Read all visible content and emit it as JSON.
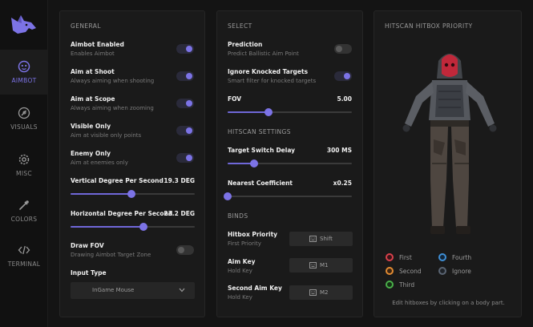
{
  "sidebar": {
    "items": [
      {
        "label": "AIMBOT",
        "icon": "aimbot-face-icon",
        "active": true
      },
      {
        "label": "VISUALS",
        "icon": "visuals-eye-icon"
      },
      {
        "label": "MISC",
        "icon": "gear-icon"
      },
      {
        "label": "COLORS",
        "icon": "eyedropper-icon"
      },
      {
        "label": "TERMINAL",
        "icon": "code-brackets-icon"
      }
    ]
  },
  "colors": {
    "accent": "#7c73e6",
    "panel": "#1a1a1a",
    "background": "#141414"
  },
  "general": {
    "title": "GENERAL",
    "toggles": [
      {
        "title": "Aimbot Enabled",
        "subtitle": "Enables Aimbot",
        "on": true
      },
      {
        "title": "Aim at Shoot",
        "subtitle": "Always aiming when shooting",
        "on": true
      },
      {
        "title": "Aim at Scope",
        "subtitle": "Always aiming when zooming",
        "on": true
      },
      {
        "title": "Visible Only",
        "subtitle": "Aim at visible only points",
        "on": true
      },
      {
        "title": "Enemy Only",
        "subtitle": "Aim at enemies only",
        "on": true
      }
    ],
    "sliders": [
      {
        "title": "Vertical Degree Per Second",
        "value": "19.3 DEG",
        "fraction": 0.49
      },
      {
        "title": "Horizontal Degree Per Second",
        "value": "23.2 DEG",
        "fraction": 0.59
      }
    ],
    "draw_fov": {
      "title": "Draw FOV",
      "subtitle": "Drawing Aimbot Target Zone",
      "on": false
    },
    "input_type": {
      "label": "Input Type",
      "value": "InGame Mouse"
    }
  },
  "select": {
    "title": "SELECT",
    "toggles": [
      {
        "title": "Prediction",
        "subtitle": "Predict Ballistic Aim Point",
        "on": false
      },
      {
        "title": "Ignore Knocked Targets",
        "subtitle": "Smart filter for knocked targets",
        "on": true
      }
    ],
    "fov": {
      "title": "FOV",
      "value": "5.00",
      "fraction": 0.33
    },
    "hitscan_title": "HITSCAN SETTINGS",
    "hitscan_sliders": [
      {
        "title": "Target Switch Delay",
        "value": "300 MS",
        "fraction": 0.21
      },
      {
        "title": "Nearest Coefficient",
        "value": "x0.25",
        "fraction": 0.0
      }
    ],
    "binds_title": "BINDS",
    "binds": [
      {
        "title": "Hitbox Priority",
        "subtitle": "First Priority",
        "key": "Shift"
      },
      {
        "title": "Aim Key",
        "subtitle": "Hold Key",
        "key": "M1"
      },
      {
        "title": "Second Aim Key",
        "subtitle": "Hold Key",
        "key": "M2"
      }
    ]
  },
  "hitbox": {
    "title": "HITSCAN HITBOX PRIORITY",
    "legend": [
      {
        "label": "First",
        "color": "#d9414b"
      },
      {
        "label": "Fourth",
        "color": "#3f8fd6"
      },
      {
        "label": "Second",
        "color": "#e08a32"
      },
      {
        "label": "Ignore",
        "color": "#5a6472"
      },
      {
        "label": "Third",
        "color": "#4ab04a"
      }
    ],
    "hint": "Edit hitboxes by clicking on a body part."
  }
}
